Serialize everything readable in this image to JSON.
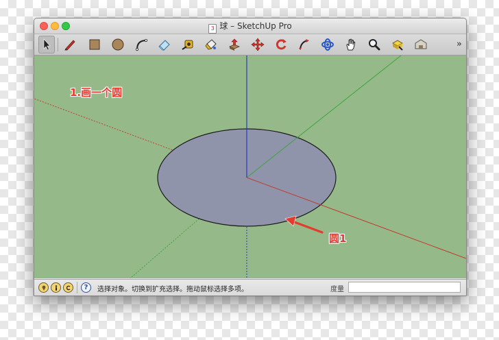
{
  "window": {
    "title": "球 – SketchUp Pro",
    "doc_icon": "3"
  },
  "toolbar": {
    "tools": [
      {
        "name": "select",
        "icon": "arrow-cursor-icon",
        "selected": true
      },
      {
        "name": "pencil",
        "icon": "pencil-icon"
      },
      {
        "name": "rectangle",
        "icon": "rectangle-icon"
      },
      {
        "name": "circle",
        "icon": "circle-icon"
      },
      {
        "name": "arc",
        "icon": "arc-icon"
      },
      {
        "name": "eraser",
        "icon": "eraser-icon"
      },
      {
        "name": "tape-measure",
        "icon": "tape-measure-icon"
      },
      {
        "name": "paint-bucket",
        "icon": "paint-bucket-icon"
      },
      {
        "name": "push-pull",
        "icon": "push-pull-icon"
      },
      {
        "name": "move",
        "icon": "move-icon"
      },
      {
        "name": "rotate",
        "icon": "rotate-icon"
      },
      {
        "name": "follow-me",
        "icon": "follow-me-icon"
      },
      {
        "name": "orbit",
        "icon": "orbit-icon"
      },
      {
        "name": "pan",
        "icon": "pan-hand-icon"
      },
      {
        "name": "zoom",
        "icon": "magnifier-icon"
      },
      {
        "name": "zoom-extents",
        "icon": "zoom-extents-icon"
      },
      {
        "name": "warehouse",
        "icon": "warehouse-icon"
      }
    ],
    "overflow_label": "»"
  },
  "viewport": {
    "annotation_step": "1.画一个圆",
    "annotation_circle": "圆1",
    "colors": {
      "background": "#96b98a",
      "circle_face": "#8f94ab",
      "axis_red": "#c03a2b",
      "axis_green": "#3aa63a",
      "axis_blue": "#2a3ac0",
      "annotation": "#e33b2e"
    }
  },
  "statusbar": {
    "message": "选择对象。切换到扩充选择。拖动鼠标选择多项。",
    "measure_label": "度量",
    "measure_value": "",
    "help_label": "?"
  }
}
